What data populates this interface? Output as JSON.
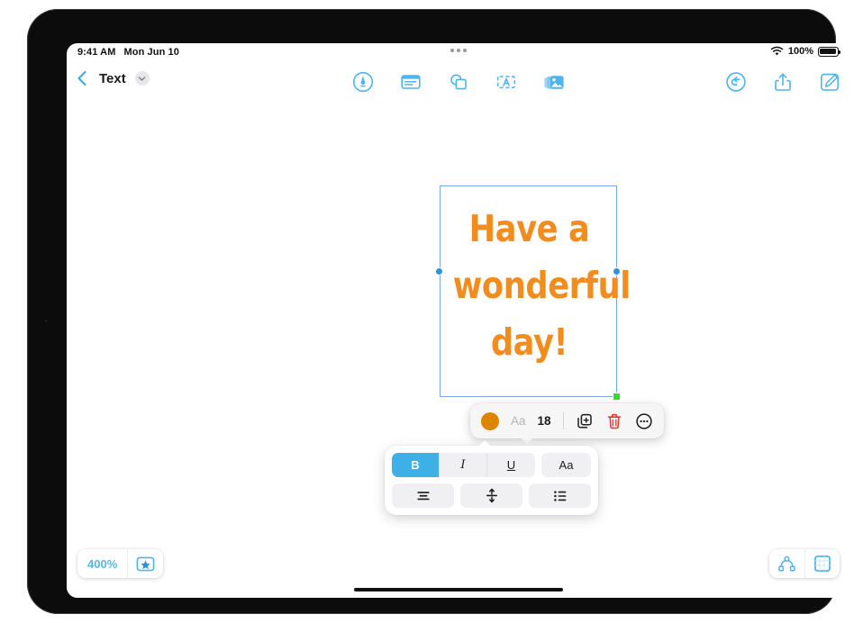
{
  "status_bar": {
    "time": "9:41 AM",
    "date": "Mon Jun 10",
    "wifi_icon": "wifi-icon",
    "battery_percent": "100%",
    "battery_icon": "battery-full-icon",
    "multitask_icon": "multitasking-dots-icon"
  },
  "nav_bar": {
    "back_icon": "back-chevron-icon",
    "title": "Text",
    "title_chevron_icon": "chevron-down-icon",
    "center_tools": [
      {
        "name": "draw-tool",
        "icon": "pen-in-circle-icon",
        "label": "Draw"
      },
      {
        "name": "text-tool",
        "icon": "text-box-icon",
        "label": "Text Box"
      },
      {
        "name": "shapes-tool",
        "icon": "shapes-icon",
        "label": "Shape"
      },
      {
        "name": "sticker-tool",
        "icon": "letter-a-frame-icon",
        "label": "Sticker"
      },
      {
        "name": "media-tool",
        "icon": "photos-stack-icon",
        "label": "Media"
      }
    ],
    "right_tools": [
      {
        "name": "undo-button",
        "icon": "undo-circle-arrow-icon",
        "label": "Undo"
      },
      {
        "name": "share-button",
        "icon": "share-up-arrow-icon",
        "label": "Share"
      },
      {
        "name": "compose-button",
        "icon": "compose-pencil-square-icon",
        "label": "Compose"
      }
    ]
  },
  "canvas": {
    "text_object": {
      "content": "Have a\nwonderful\nday!",
      "color": "#F28C1E",
      "selection_border_color": "#7BA7E8",
      "resize_handle_color": "#2F93E0",
      "corner_handle_color": "#2BE321"
    }
  },
  "format_bar": {
    "color_swatch": "#DD8500",
    "color_swatch_name": "text-color-swatch",
    "font_label": "Aa",
    "font_size": "18",
    "duplicate_icon": "duplicate-squares-icon",
    "delete_icon": "trash-icon",
    "delete_color": "#E8332A",
    "more_icon": "more-ellipsis-circle-icon"
  },
  "style_panel": {
    "row1": [
      {
        "name": "bold-button",
        "label": "B",
        "active": true
      },
      {
        "name": "italic-button",
        "label": "I",
        "active": false
      },
      {
        "name": "underline-button",
        "label": "U",
        "active": false
      },
      {
        "name": "font-style-button",
        "label": "Aa",
        "active": false
      }
    ],
    "row2": [
      {
        "name": "text-alignment-button",
        "icon": "align-center-icon"
      },
      {
        "name": "line-spacing-button",
        "icon": "line-spacing-icon"
      },
      {
        "name": "bulleted-list-button",
        "icon": "bulleted-list-icon"
      }
    ],
    "active_color": "#3DB0E8"
  },
  "bottom_bar": {
    "zoom_level": "400%",
    "favorite_icon": "star-in-rectangle-icon",
    "view_icons": [
      {
        "name": "connections-view-button",
        "icon": "node-graph-icon"
      },
      {
        "name": "page-view-button",
        "icon": "grid-page-icon"
      }
    ]
  },
  "bezel": {
    "side_glyph": "·"
  },
  "accent_color": "#4FB3EC"
}
